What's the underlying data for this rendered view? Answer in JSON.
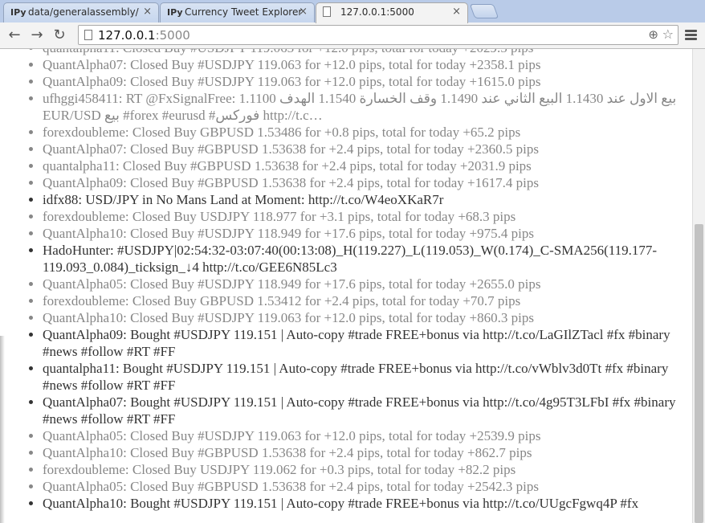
{
  "tabs": [
    {
      "favicon": "IPy",
      "title": "data/generalassembly/",
      "close": "×",
      "active": false
    },
    {
      "favicon": "IPy",
      "title": "Currency Tweet Explorer",
      "close": "×",
      "active": false
    },
    {
      "favicon": "page-icon",
      "title": "127.0.0.1:5000",
      "close": "×",
      "active": true
    }
  ],
  "toolbar": {
    "back_icon": "←",
    "forward_icon": "→",
    "reload_icon": "↻",
    "url_host": "127.0.0.1",
    "url_port": ":5000",
    "zoom_icon": "⊕",
    "star_icon": "☆"
  },
  "tweets": [
    {
      "text": "quantalpha11: Closed Buy #USDJPY 119.063 for +12.0 pips, total for today +2029.5 pips",
      "style": "old"
    },
    {
      "text": "QuantAlpha07: Closed Buy #USDJPY 119.063 for +12.0 pips, total for today +2358.1 pips",
      "style": "old"
    },
    {
      "text": "QuantAlpha09: Closed Buy #USDJPY 119.063 for +12.0 pips, total for today +1615.0 pips",
      "style": "old"
    },
    {
      "text": "ufhggi458411: RT @FxSignalFree: بيع الاول عند 1.1430 البيع الثاني عند 1.1490 وقف الخسارة 1.1540 الهدف 1.1100 EUR/USD بيع #forex #eurusd #فوركس http://t.c…",
      "style": "old"
    },
    {
      "text": "forexdoubleme: Closed Buy GBPUSD 1.53486 for +0.8 pips, total for today +65.2 pips",
      "style": "old"
    },
    {
      "text": "QuantAlpha07: Closed Buy #GBPUSD 1.53638 for +2.4 pips, total for today +2360.5 pips",
      "style": "old"
    },
    {
      "text": "quantalpha11: Closed Buy #GBPUSD 1.53638 for +2.4 pips, total for today +2031.9 pips",
      "style": "old"
    },
    {
      "text": "QuantAlpha09: Closed Buy #GBPUSD 1.53638 for +2.4 pips, total for today +1617.4 pips",
      "style": "old"
    },
    {
      "text": "idfx88: USD/JPY in No Mans Land at Moment: http://t.co/W4eoXKaR7r",
      "style": "new"
    },
    {
      "text": "forexdoubleme: Closed Buy USDJPY 118.977 for +3.1 pips, total for today +68.3 pips",
      "style": "old"
    },
    {
      "text": "QuantAlpha10: Closed Buy #USDJPY 118.949 for +17.6 pips, total for today +975.4 pips",
      "style": "old"
    },
    {
      "text": "HadoHunter: #USDJPY|02:54:32-03:07:40(00:13:08)_H(119.227)_L(119.053)_W(0.174)_C-SMA256(119.177-119.093_0.084)_ticksign_↓4 http://t.co/GEE6N85Lc3",
      "style": "new"
    },
    {
      "text": "QuantAlpha05: Closed Buy #USDJPY 118.949 for +17.6 pips, total for today +2655.0 pips",
      "style": "old"
    },
    {
      "text": "forexdoubleme: Closed Buy GBPUSD 1.53412 for +2.4 pips, total for today +70.7 pips",
      "style": "old"
    },
    {
      "text": "QuantAlpha10: Closed Buy #USDJPY 119.063 for +12.0 pips, total for today +860.3 pips",
      "style": "old"
    },
    {
      "text": "QuantAlpha09: Bought #USDJPY 119.151 | Auto-copy #trade FREE+bonus via http://t.co/LaGIlZTacl #fx #binary #news #follow #RT #FF",
      "style": "new"
    },
    {
      "text": "quantalpha11: Bought #USDJPY 119.151 | Auto-copy #trade FREE+bonus via http://t.co/vWblv3d0Tt #fx #binary #news #follow #RT #FF",
      "style": "new"
    },
    {
      "text": "QuantAlpha07: Bought #USDJPY 119.151 | Auto-copy #trade FREE+bonus via http://t.co/4g95T3LFbI #fx #binary #news #follow #RT #FF",
      "style": "new"
    },
    {
      "text": "QuantAlpha05: Closed Buy #USDJPY 119.063 for +12.0 pips, total for today +2539.9 pips",
      "style": "old"
    },
    {
      "text": "QuantAlpha10: Closed Buy #GBPUSD 1.53638 for +2.4 pips, total for today +862.7 pips",
      "style": "old"
    },
    {
      "text": "forexdoubleme: Closed Buy USDJPY 119.062 for +0.3 pips, total for today +82.2 pips",
      "style": "old"
    },
    {
      "text": "QuantAlpha05: Closed Buy #GBPUSD 1.53638 for +2.4 pips, total for today +2542.3 pips",
      "style": "old"
    },
    {
      "text": "QuantAlpha10: Bought #USDJPY 119.151 | Auto-copy #trade FREE+bonus via http://t.co/UUgcFgwq4P #fx",
      "style": "new"
    }
  ]
}
